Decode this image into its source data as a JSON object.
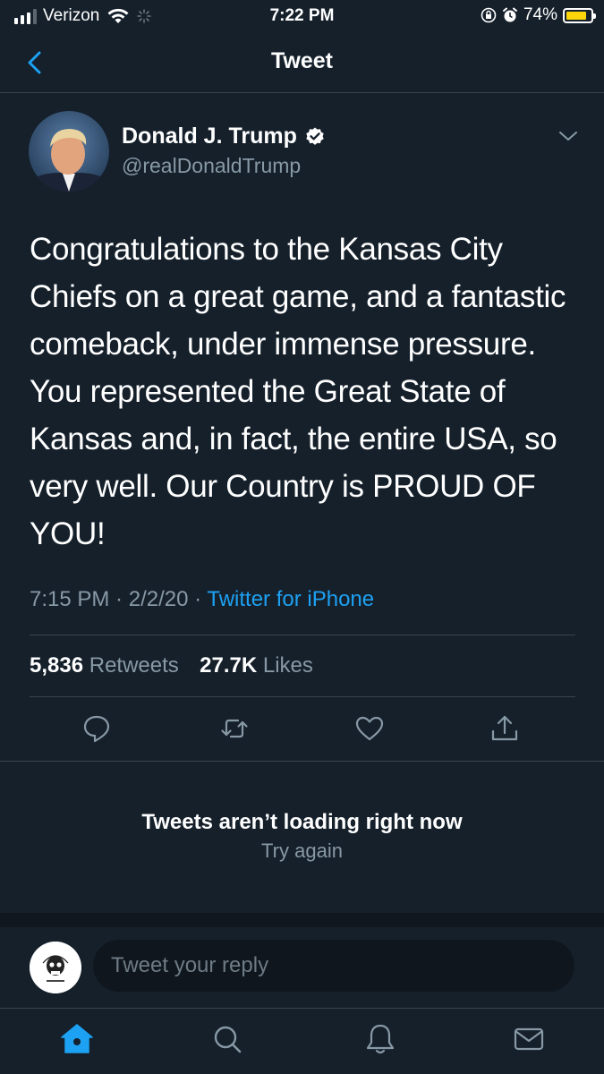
{
  "status_bar": {
    "carrier": "Verizon",
    "time": "7:22 PM",
    "battery_percent": "74%",
    "battery_color": "#ffd60a"
  },
  "nav": {
    "title": "Tweet",
    "back_icon": "chevron-left-icon"
  },
  "tweet": {
    "author_name": "Donald J. Trump",
    "author_handle": "@realDonaldTrump",
    "verified_icon": "verified-badge-icon",
    "text": "Congratulations to the Kansas City Chiefs on a great game, and a fantastic comeback, under immense pressure. You represented the Great State of Kansas and, in fact, the entire USA, so very well. Our Country is PROUD OF YOU!",
    "time": "7:15 PM",
    "date": "2/2/20",
    "separator": " · ",
    "source": "Twitter for iPhone",
    "retweets_count": "5,836",
    "retweets_label": "Retweets",
    "likes_count": "27.7K",
    "likes_label": "Likes"
  },
  "actions": [
    "reply-icon",
    "retweet-icon",
    "like-icon",
    "share-icon"
  ],
  "error": {
    "title": "Tweets aren’t loading right now",
    "retry": "Try again"
  },
  "reply": {
    "placeholder": "Tweet your reply"
  },
  "tab_bar": [
    "home-icon",
    "search-icon",
    "notifications-icon",
    "messages-icon"
  ],
  "colors": {
    "background": "#15202b",
    "accent": "#1da1f2",
    "secondary_text": "#8899a6",
    "divider": "#38444d"
  }
}
